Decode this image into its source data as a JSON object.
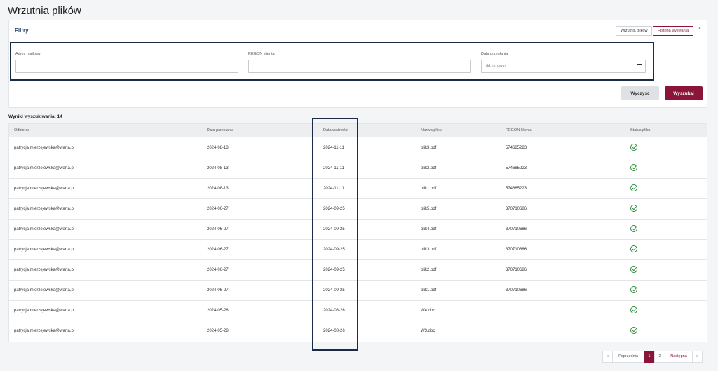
{
  "page": {
    "title": "Wrzutnia plików"
  },
  "filters": {
    "title": "Filtry",
    "tab_upload": "Wrzutnia plików",
    "tab_history": "Historia wysyłania",
    "email_label": "Adres mailowy",
    "email_value": "",
    "regon_label": "REGON klienta",
    "regon_value": "",
    "date_label": "Data przesłania",
    "date_placeholder": "dd.mm.yyyy",
    "clear_label": "Wyczyść",
    "search_label": "Wyszukaj"
  },
  "results": {
    "count_label": "Wyniki wyszukiwania: 14",
    "columns": [
      "Odbiorca",
      "Data przesłania",
      "Data ważności",
      "Nazwa pliku",
      "REGON klienta",
      "Status pliku"
    ],
    "rows": [
      {
        "recipient": "patrycja.mierzejewska@warta.pl",
        "sent": "2024-08-13",
        "expires": "2024-11-11",
        "file": "plik3.pdf",
        "regon": "574685223",
        "status": "ok"
      },
      {
        "recipient": "patrycja.mierzejewska@warta.pl",
        "sent": "2024-08-13",
        "expires": "2024-11-11",
        "file": "plik2.pdf",
        "regon": "574685223",
        "status": "ok"
      },
      {
        "recipient": "patrycja.mierzejewska@warta.pl",
        "sent": "2024-08-13",
        "expires": "2024-11-11",
        "file": "plik1.pdf",
        "regon": "574685223",
        "status": "ok"
      },
      {
        "recipient": "patrycja.mierzejewska@warta.pl",
        "sent": "2024-06-27",
        "expires": "2024-09-25",
        "file": "plik5.pdf",
        "regon": "370710686",
        "status": "ok"
      },
      {
        "recipient": "patrycja.mierzejewska@warta.pl",
        "sent": "2024-06-27",
        "expires": "2024-09-25",
        "file": "plik4.pdf",
        "regon": "370710686",
        "status": "ok"
      },
      {
        "recipient": "patrycja.mierzejewska@warta.pl",
        "sent": "2024-06-27",
        "expires": "2024-09-25",
        "file": "plik3.pdf",
        "regon": "370710686",
        "status": "ok"
      },
      {
        "recipient": "patrycja.mierzejewska@warta.pl",
        "sent": "2024-06-27",
        "expires": "2024-09-25",
        "file": "plik2.pdf",
        "regon": "370710686",
        "status": "ok"
      },
      {
        "recipient": "patrycja.mierzejewska@warta.pl",
        "sent": "2024-06-27",
        "expires": "2024-09-25",
        "file": "plik1.pdf",
        "regon": "370710686",
        "status": "ok"
      },
      {
        "recipient": "patrycja.mierzejewska@warta.pl",
        "sent": "2024-05-28",
        "expires": "2024-08-26",
        "file": "W4.doc",
        "regon": "",
        "status": "ok"
      },
      {
        "recipient": "patrycja.mierzejewska@warta.pl",
        "sent": "2024-05-28",
        "expires": "2024-08-26",
        "file": "W3.doc",
        "regon": "",
        "status": "ok"
      }
    ]
  },
  "pagination": {
    "first": "«",
    "prev": "Poprzednia",
    "pages": [
      "1",
      "2"
    ],
    "active_page": "1",
    "next": "Następna",
    "last": "»"
  },
  "icons": {
    "collapse": "chevron-up-icon",
    "calendar": "calendar-icon",
    "status": "check-circle-icon"
  },
  "colors": {
    "accent": "#8b1538",
    "highlight_box": "#1b2b45",
    "success": "#2f8c3d"
  }
}
